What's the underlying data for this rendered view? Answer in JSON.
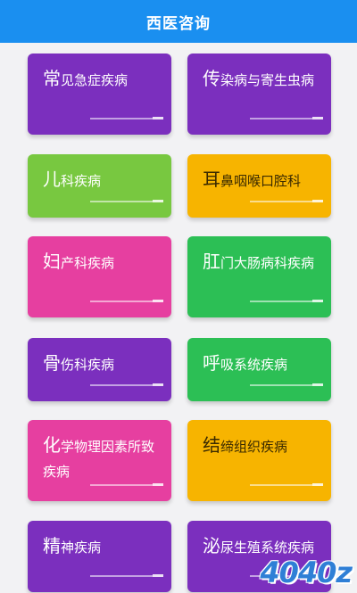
{
  "header": {
    "title": "西医咨询"
  },
  "colors": {
    "header": "#1a8ff0",
    "purple": "#7b2fbe",
    "green": "#78c840",
    "orange": "#f7b400",
    "pink": "#e63fa0",
    "emerald": "#2cbf55"
  },
  "categories": [
    {
      "first": "常",
      "rest": "见急症疾病",
      "color": "#7b2fbe"
    },
    {
      "first": "传",
      "rest": "染病与寄生虫病",
      "color": "#7b2fbe"
    },
    {
      "first": "儿",
      "rest": "科疾病",
      "color": "#78c840"
    },
    {
      "first": "耳",
      "rest": "鼻咽喉口腔科",
      "color": "#f7b400",
      "dark": true
    },
    {
      "first": "妇",
      "rest": "产科疾病",
      "color": "#e63fa0"
    },
    {
      "first": "肛",
      "rest": "门大肠病科疾病",
      "color": "#2cbf55"
    },
    {
      "first": "骨",
      "rest": "伤科疾病",
      "color": "#7b2fbe"
    },
    {
      "first": "呼",
      "rest": "吸系统疾病",
      "color": "#2cbf55"
    },
    {
      "first": "化",
      "rest": "学物理因素所致疾病",
      "color": "#e63fa0"
    },
    {
      "first": "结",
      "rest": "缔组织疾病",
      "color": "#f7b400",
      "dark": true
    },
    {
      "first": "精",
      "rest": "神疾病",
      "color": "#7b2fbe"
    },
    {
      "first": "泌",
      "rest": "尿生殖系统疾病",
      "color": "#7b2fbe"
    }
  ],
  "watermark": "4040z"
}
